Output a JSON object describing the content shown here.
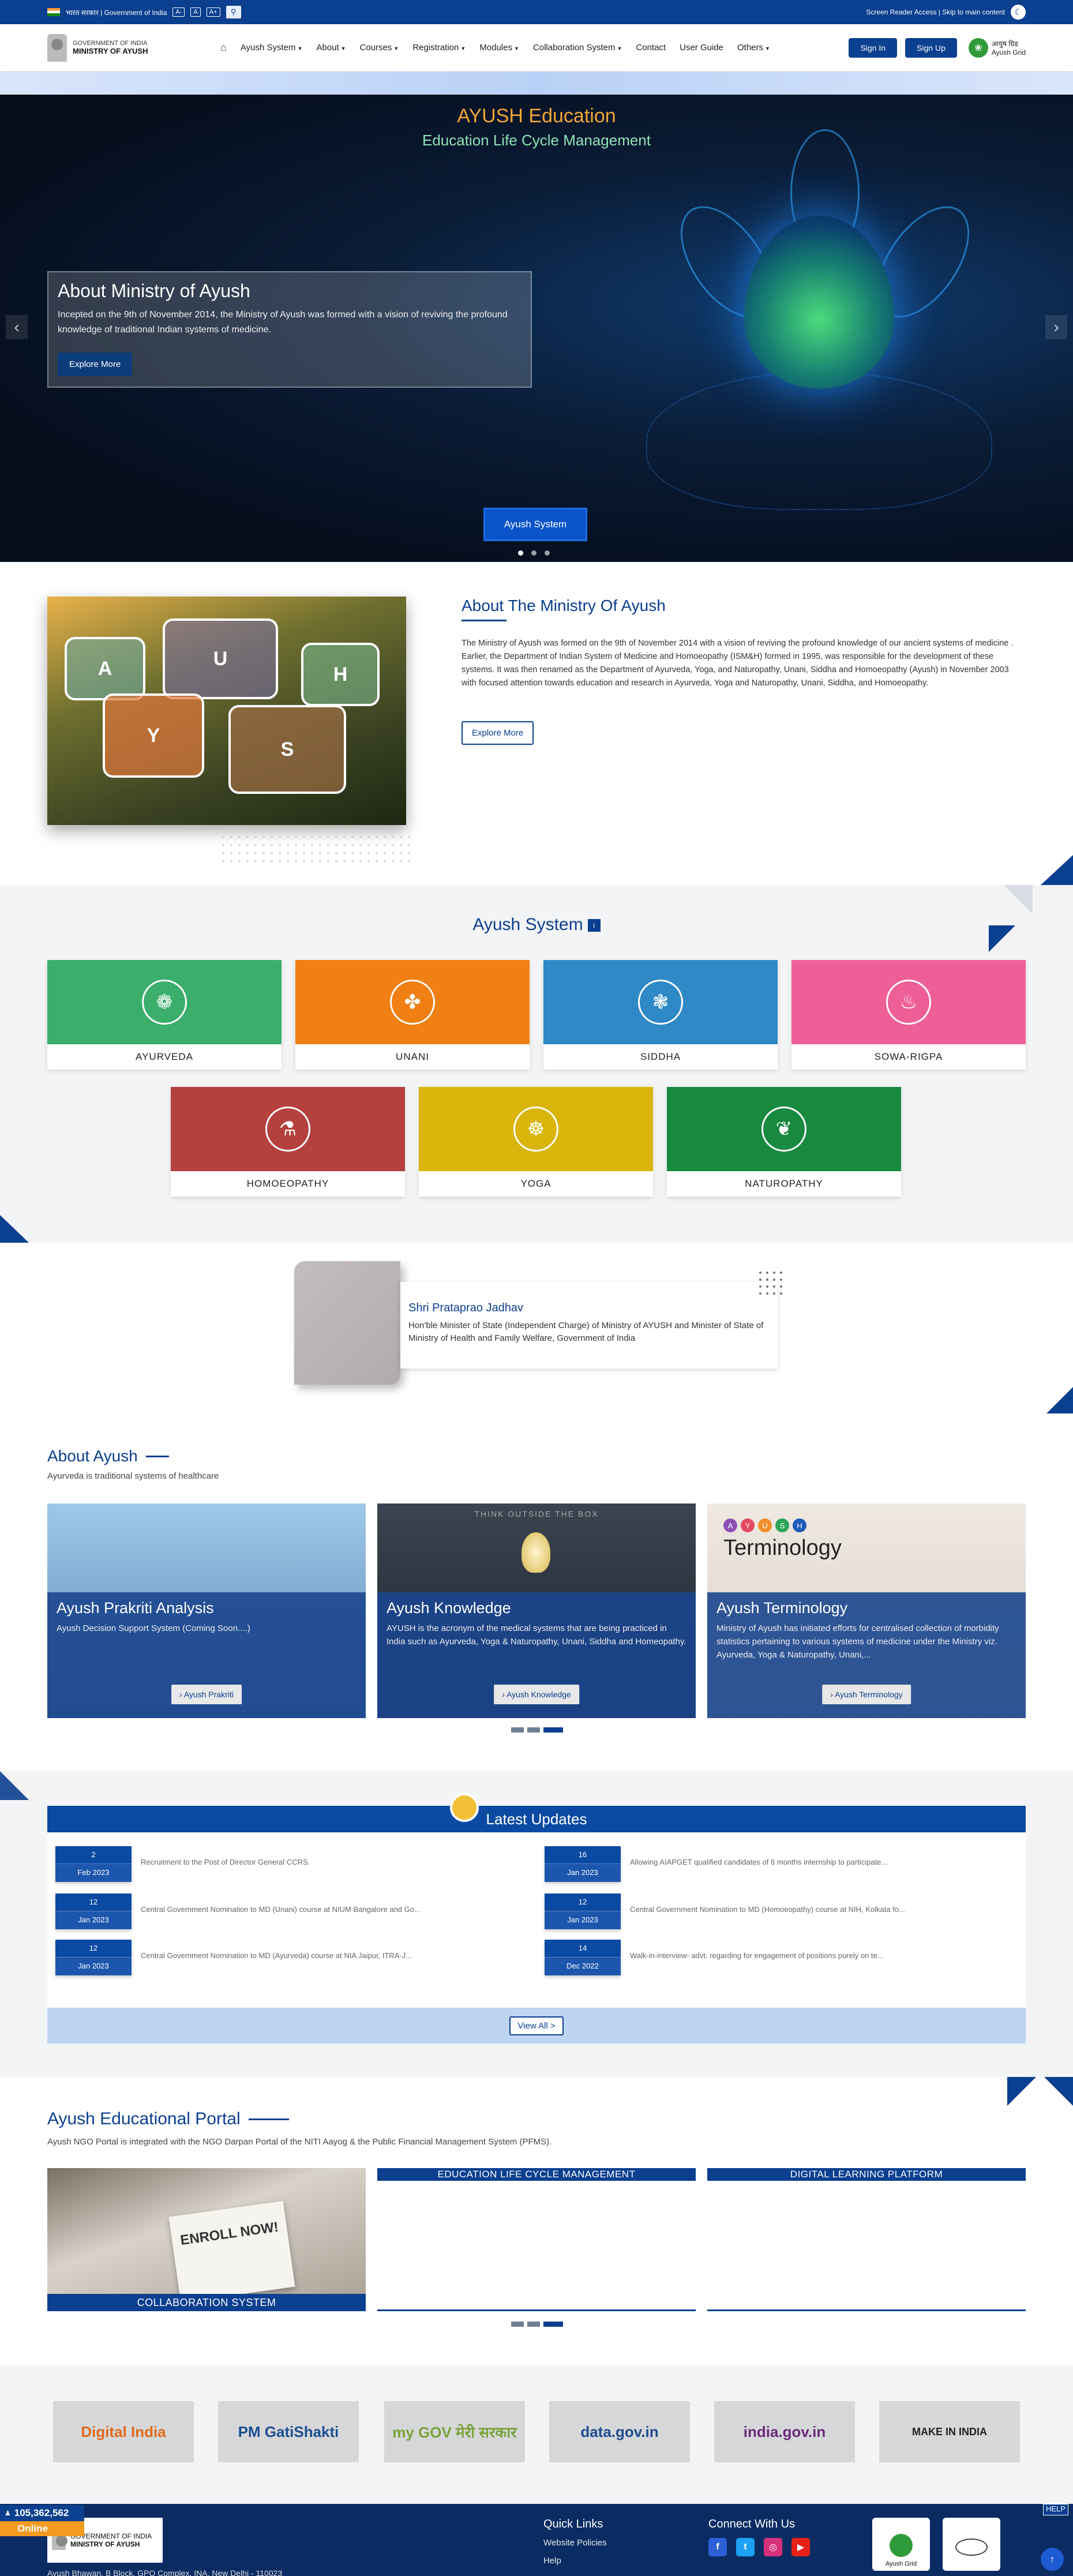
{
  "topbar": {
    "gov_text": "भारत सरकार | Government of India",
    "font_small": "A-",
    "font_normal": "A",
    "font_large": "A+",
    "screen_reader": "Screen Reader Access | Skip to main content"
  },
  "header": {
    "gov_line": "GOVERNMENT OF INDIA",
    "ministry": "MINISTRY OF AYUSH",
    "nav": [
      {
        "label": "Ayush System",
        "caret": true
      },
      {
        "label": "About",
        "caret": true
      },
      {
        "label": "Courses",
        "caret": true
      },
      {
        "label": "Registration",
        "caret": true
      },
      {
        "label": "Modules",
        "caret": true
      },
      {
        "label": "Collaboration System",
        "caret": true
      },
      {
        "label": "Contact",
        "caret": false
      },
      {
        "label": "User Guide",
        "caret": false
      },
      {
        "label": "Others",
        "caret": true
      }
    ],
    "sign_in": "Sign In",
    "sign_up": "Sign Up",
    "grid_hindi": "आयुष ग्रिड",
    "grid_en": "Ayush Grid"
  },
  "hero": {
    "title": "AYUSH Education",
    "subtitle": "Education Life Cycle Management",
    "card_title": "About Ministry of Ayush",
    "card_desc": "Incepted on the 9th of November 2014, the Ministry of Ayush was formed with a vision of reviving the profound knowledge of traditional Indian systems of medicine.",
    "card_button": "Explore More",
    "system_button": "Ayush System",
    "prev": "‹",
    "next": "›"
  },
  "about": {
    "title": "About The Ministry Of Ayush",
    "text": "The Ministry of Ayush was formed on the 9th of November 2014 with a vision of reviving the profound knowledge of our ancient systems of medicine . Earlier, the Department of Indian System of Medicine and Homoeopathy (ISM&H) formed in 1995, was responsible for the development of these systems. It was then renamed as the Department of Ayurveda, Yoga, and Naturopathy, Unani, Siddha and Homoeopathy (Ayush) in November 2003 with focused attention towards education and research in Ayurveda, Yoga and Naturopathy, Unani, Siddha, and Homoeopathy.",
    "button": "Explore More",
    "letters": [
      "A",
      "U",
      "H",
      "Y",
      "S"
    ]
  },
  "ayush_system": {
    "title": "Ayush System",
    "tiles": [
      {
        "label": "AYURVEDA",
        "color": "#3aae6a",
        "icon": "ayurveda-icon",
        "glyph": "❁"
      },
      {
        "label": "UNANI",
        "color": "#f07f14",
        "icon": "unani-icon",
        "glyph": "✤"
      },
      {
        "label": "SIDDHA",
        "color": "#2e89c6",
        "icon": "siddha-icon",
        "glyph": "❃"
      },
      {
        "label": "SOWA-RIGPA",
        "color": "#ee5f98",
        "icon": "sowa-rigpa-icon",
        "glyph": "♨"
      },
      {
        "label": "HOMOEOPATHY",
        "color": "#b5413e",
        "icon": "homoeopathy-icon",
        "glyph": "⚗"
      },
      {
        "label": "YOGA",
        "color": "#d9b50c",
        "icon": "yoga-icon",
        "glyph": "☸"
      },
      {
        "label": "NATUROPATHY",
        "color": "#178a3f",
        "icon": "naturopathy-icon",
        "glyph": "❦"
      }
    ]
  },
  "minister": {
    "name": "Shri Prataprao Jadhav",
    "desc": "Hon'ble Minister of State (Independent Charge) of Ministry of AYUSH and Minister of State of Ministry of Health and Family Welfare, Government of India"
  },
  "about_ayush": {
    "title": "About Ayush",
    "subtitle": "Ayurveda is traditional systems of healthcare",
    "cards": [
      {
        "title": "Ayush Prakriti Analysis",
        "desc": "Ayush Decision Support System (Coming Soon....)",
        "button": "Ayush Prakriti"
      },
      {
        "title": "Ayush Knowledge",
        "desc": "AYUSH is the acronym of the medical systems that are being practiced in India such as Ayurveda, Yoga & Naturopathy, Unani, Siddha and Homeopathy.",
        "button": "Ayush Knowledge"
      },
      {
        "title": "Ayush Terminology",
        "desc": "Ministry of Ayush has initiated efforts for centralised collection of morbidity statistics pertaining to various systems of medicine under the Ministry viz. Ayurveda, Yoga & Naturopathy, Unani,...",
        "button": "Ayush Terminology",
        "img_text": "Terminology",
        "img_letters": [
          "A",
          "Y",
          "U",
          "S",
          "H"
        ]
      }
    ],
    "card2_img_text": "THINK OUTSIDE THE BOX"
  },
  "updates": {
    "title": "Latest Updates",
    "left": [
      {
        "day": "2",
        "month": "Feb 2023",
        "text": "Recruitment to the Post of Director General CCRS."
      },
      {
        "day": "12",
        "month": "Jan 2023",
        "text": "Central Government Nomination to MD (Unani) course at NIUM Bangalore and Go..."
      },
      {
        "day": "12",
        "month": "Jan 2023",
        "text": "Central Government Nomination to MD (Ayurveda) course at NIA Jaipur, ITRA-J..."
      }
    ],
    "right": [
      {
        "day": "16",
        "month": "Jan 2023",
        "text": "Allowing AIAPGET qualified candidates of 6 months internship to participate..."
      },
      {
        "day": "12",
        "month": "Jan 2023",
        "text": "Central Government Nomination to MD (Homoeopathy) course at NIH, Kolkata fo..."
      },
      {
        "day": "14",
        "month": "Dec 2022",
        "text": "Walk-in-interview- advt. regarding for engagement of positions purely on te..."
      }
    ],
    "view_all": "View All >"
  },
  "portal": {
    "title": "Ayush Educational Portal",
    "subtitle": "Ayush NGO Portal is integrated with the NGO Darpan Portal of the NITI Aayog & the Public Financial Management System (PFMS).",
    "cards": [
      {
        "label": "COLLABORATION SYSTEM",
        "img_text": "ENROLL NOW!"
      },
      {
        "label": "EDUCATION LIFE CYCLE MANAGEMENT"
      },
      {
        "label": "DIGITAL LEARNING PLATFORM"
      }
    ]
  },
  "partners": [
    {
      "name": "Digital India",
      "color": "#e06a1b"
    },
    {
      "name": "PM GatiShakti",
      "color": "#1d4f91"
    },
    {
      "name": "my GOV मेरी सरकार",
      "color": "#7aa23a"
    },
    {
      "name": "data.gov.in",
      "color": "#1f4b8f"
    },
    {
      "name": "india.gov.in",
      "color": "#6b2a7a"
    },
    {
      "name": "MAKE IN INDIA",
      "color": "#222222"
    }
  ],
  "footer": {
    "logo_line1": "GOVERNMENT OF INDIA",
    "logo_line2": "MINISTRY OF AYUSH",
    "address": "Ayush Bhawan, B Block, GPO Complex, INA, New Delhi - 110023",
    "quick_links_title": "Quick Links",
    "quick_links": [
      "Website Policies",
      "Help"
    ],
    "connect_title": "Connect With Us",
    "social": [
      {
        "icon": "facebook-icon",
        "glyph": "f",
        "color": "#2d5fd6"
      },
      {
        "icon": "twitter-icon",
        "glyph": "t",
        "color": "#1da1f2"
      },
      {
        "icon": "instagram-icon",
        "glyph": "◎",
        "color": "#d6307a"
      },
      {
        "icon": "youtube-icon",
        "glyph": "▶",
        "color": "#e62117"
      }
    ],
    "badge1": "Ayush Grid",
    "counter": "105,362,562",
    "online": "Online",
    "help": "HELP"
  }
}
